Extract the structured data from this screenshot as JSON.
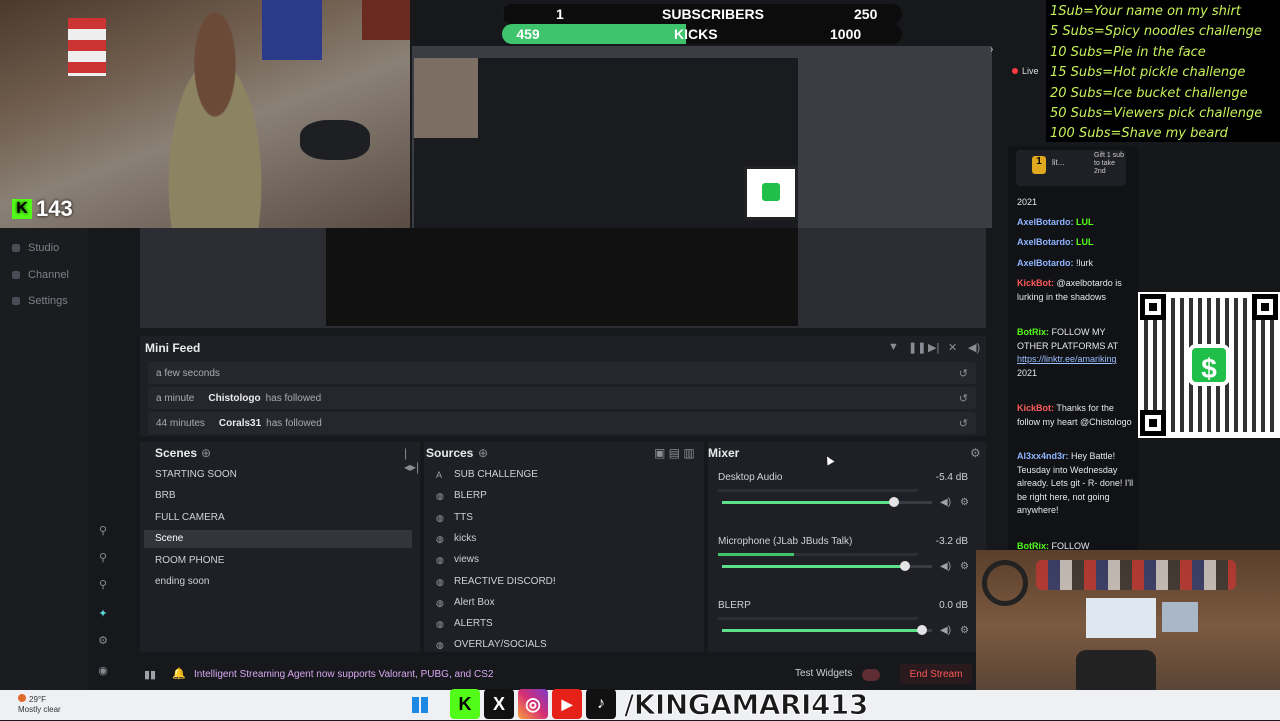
{
  "goals": {
    "subs_current": "1",
    "subs_label": "SUBSCRIBERS",
    "subs_target": "250",
    "subs_progress": 0.004,
    "kicks_current": "459",
    "kicks_label": "KICKS",
    "kicks_target": "1000",
    "kicks_progress": 0.459
  },
  "webcam": {
    "kick_logo": "K",
    "viewer_count": "143"
  },
  "nav": {
    "items": [
      "Studio",
      "Channel",
      "Settings"
    ]
  },
  "minifeed": {
    "title": "Mini Feed",
    "rows": [
      {
        "time": "a few seconds",
        "user": "",
        "action": ""
      },
      {
        "time": "a minute",
        "user": "Chistologo",
        "action": "has followed"
      },
      {
        "time": "44 minutes",
        "user": "Corals31",
        "action": "has followed"
      }
    ],
    "replay_icon": "↺"
  },
  "scenes": {
    "title": "Scenes",
    "items": [
      "STARTING SOON",
      "BRB",
      "FULL CAMERA",
      "Scene",
      "ROOM PHONE",
      "ending soon"
    ],
    "active_index": 3
  },
  "sources": {
    "title": "Sources",
    "items": [
      "SUB CHALLENGE",
      "BLERP",
      "TTS",
      "kicks",
      "views",
      "REACTIVE DISCORD!",
      "Alert Box",
      "ALERTS",
      "OVERLAY/SOCIALS"
    ]
  },
  "mixer": {
    "title": "Mixer",
    "channels": [
      {
        "name": "Desktop Audio",
        "db": "-5.4 dB",
        "volume": 0.82,
        "level": 0.0
      },
      {
        "name": "Microphone (JLab JBuds Talk)",
        "db": "-3.2 dB",
        "volume": 0.87,
        "level": 0.38
      },
      {
        "name": "BLERP",
        "db": "0.0 dB",
        "volume": 0.95,
        "level": 0.0
      }
    ]
  },
  "bottombar": {
    "announcement": "Intelligent Streaming Agent now supports Valorant, PUBG, and CS2",
    "test_widgets": "Test Widgets",
    "end_stream": "End Stream"
  },
  "challenges": [
    "1Sub=Your name on my shirt",
    "5 Subs=Spicy noodles challenge",
    "10 Subs=Pie in the face",
    "15 Subs=Hot pickle challenge",
    "20 Subs=Ice bucket challenge",
    "50 Subs=Viewers pick challenge",
    "100 Subs=Shave my beard"
  ],
  "live_label": "Live",
  "gift": {
    "name": "lit...",
    "text": "Gift 1 sub to take 2nd",
    "coin": "1"
  },
  "chat": {
    "year_line": "2021",
    "messages": [
      {
        "user": "AxelBotardo:",
        "text": "LUL"
      },
      {
        "user": "AxelBotardo:",
        "text": "LUL"
      },
      {
        "user": "AxelBotardo:",
        "text": "!lurk"
      },
      {
        "user": "KickBot:",
        "text": "@axelbotardo is lurking in the shadows"
      },
      {
        "user": "BotRix:",
        "text": "FOLLOW MY OTHER PLATFORMS AT",
        "link": "https://linktr.ee/amariking",
        "after": "2021"
      },
      {
        "user": "KickBot:",
        "text": "Thanks for the follow my heart @Chistologo"
      },
      {
        "user": "Al3xx4nd3r:",
        "text": "Hey Battle! Teusday into Wednesday already. Lets git - R- done! I'll be right here, not going anywhere!"
      },
      {
        "user": "BotRix:",
        "text": "FOLLOW"
      }
    ]
  },
  "taskbar": {
    "weather_temp": "29°F",
    "weather_desc": "Mostly clear",
    "handle": "/KINGAMARI413",
    "socials": [
      "kick",
      "x",
      "instagram",
      "youtube",
      "tiktok"
    ]
  },
  "colors": {
    "kick_green": "#53fc18",
    "subs_bar": "#0c0c0c",
    "kicks_bar": "#3ec46d",
    "challenge_text": "#c7f25a",
    "end_stream": "#ff5a5a"
  }
}
